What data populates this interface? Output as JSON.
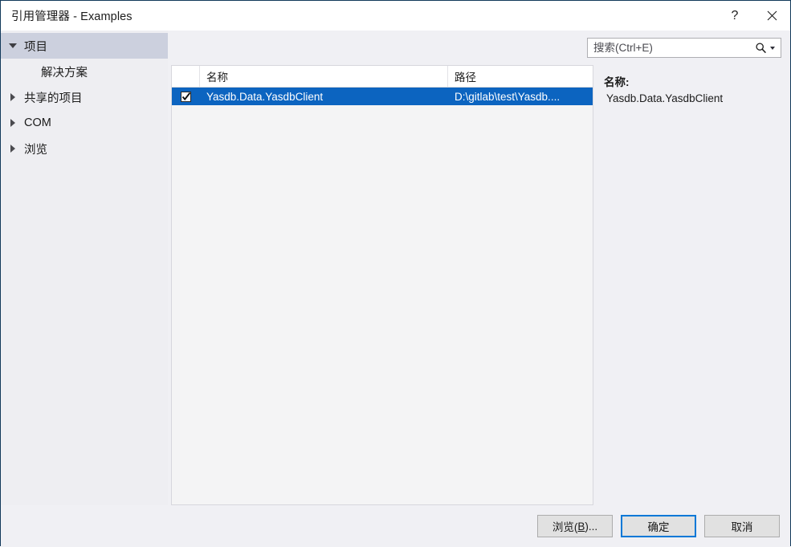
{
  "window": {
    "title": "引用管理器 - Examples",
    "help_button": "?",
    "close_button": "✕"
  },
  "sidebar": {
    "items": [
      {
        "label": "项目",
        "twisty": "down",
        "selected": true,
        "indent": 0
      },
      {
        "label": "解决方案",
        "twisty": "none",
        "selected": false,
        "indent": 1
      },
      {
        "label": "共享的项目",
        "twisty": "right",
        "selected": false,
        "indent": 0
      },
      {
        "label": "COM",
        "twisty": "right",
        "selected": false,
        "indent": 0
      },
      {
        "label": "浏览",
        "twisty": "right",
        "selected": false,
        "indent": 0
      }
    ]
  },
  "search": {
    "placeholder": "搜索(Ctrl+E)",
    "value": "",
    "icon": "search-icon",
    "dropdown_icon": "chevron-down-icon"
  },
  "list": {
    "columns": [
      "",
      "名称",
      "路径"
    ],
    "rows": [
      {
        "checked": true,
        "name": "Yasdb.Data.YasdbClient",
        "path": "D:\\gitlab\\test\\Yasdb...."
      }
    ]
  },
  "details": {
    "name_label": "名称:",
    "name_value": "Yasdb.Data.YasdbClient"
  },
  "footer": {
    "browse_label_prefix": "浏览(",
    "browse_accel": "B",
    "browse_label_suffix": ")...",
    "ok_label": "确定",
    "cancel_label": "取消"
  },
  "colors": {
    "selection_blue": "#0c64c0",
    "sidebar_selection": "#ccd0de",
    "default_button_border": "#0078d7",
    "window_border": "#12395b"
  }
}
